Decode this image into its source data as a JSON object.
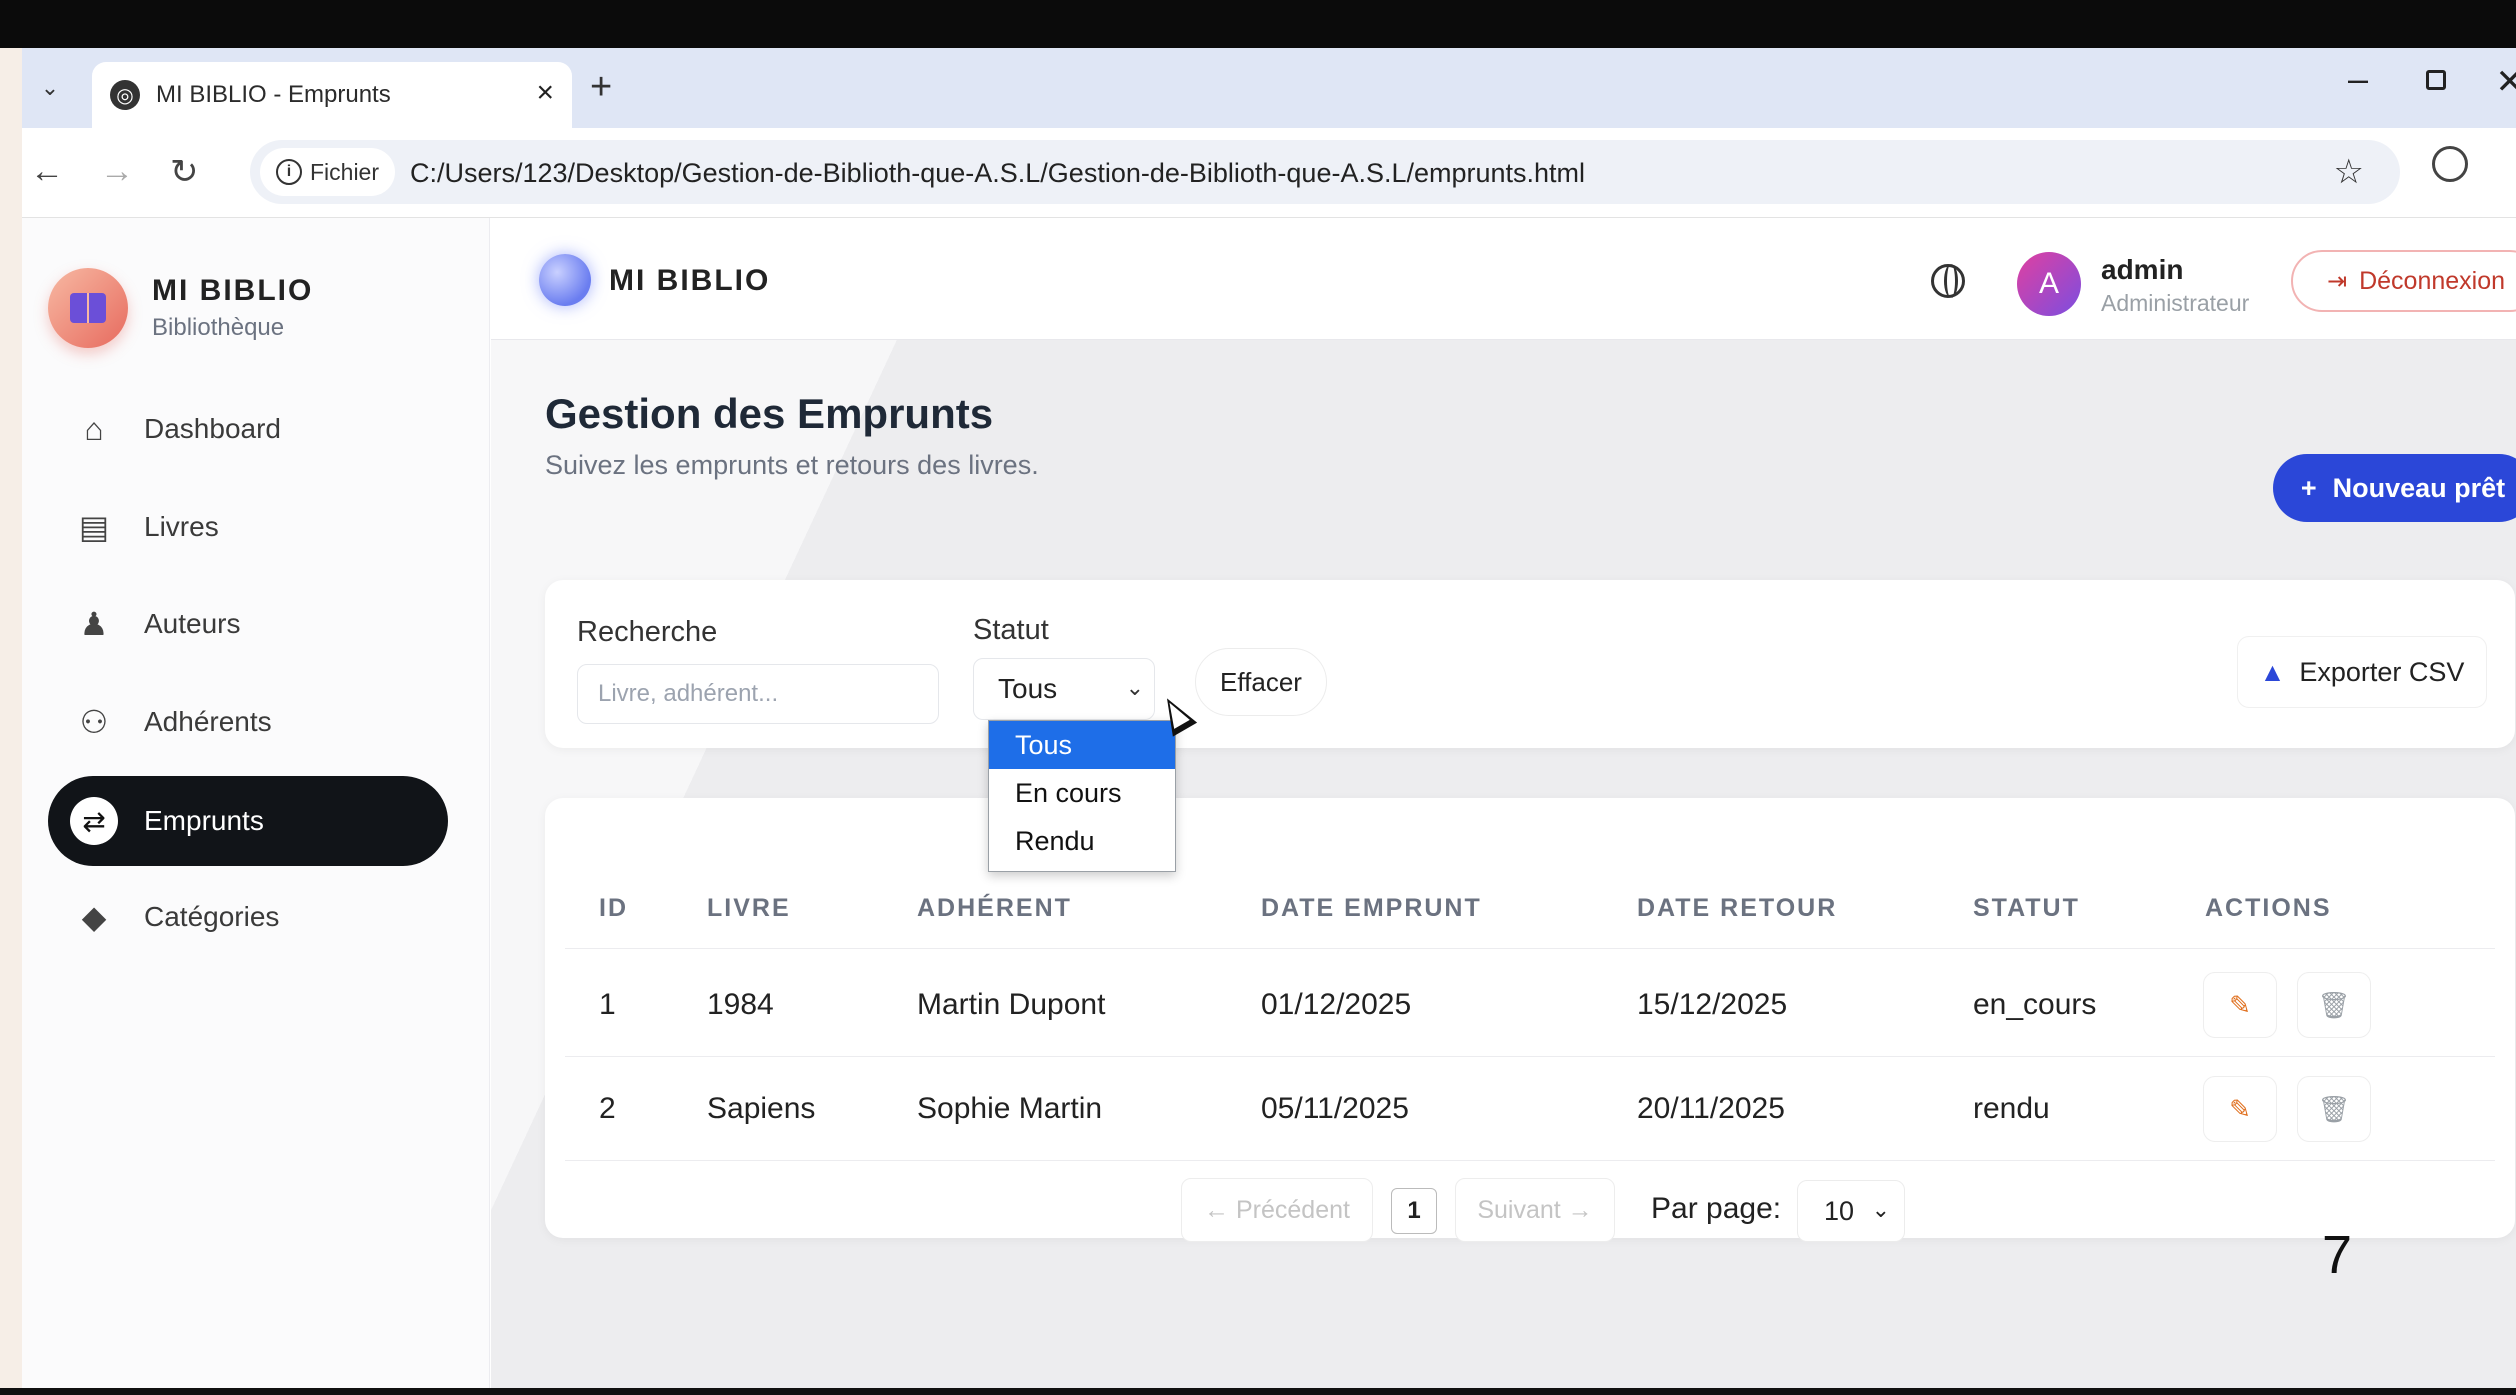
{
  "browser": {
    "tab_title": "MI BIBLIO - Emprunts",
    "tab_close": "×",
    "new_tab": "+",
    "info_label": "Fichier",
    "url": "C:/Users/123/Desktop/Gestion-de-Biblioth-que-A.S.L/Gestion-de-Biblioth-que-A.S.L/emprunts.html"
  },
  "sidebar": {
    "brand_name": "MI BIBLIO",
    "brand_sub": "Bibliothèque",
    "items": [
      {
        "label": "Dashboard",
        "icon": "home-icon",
        "active": false
      },
      {
        "label": "Livres",
        "icon": "book-icon",
        "active": false
      },
      {
        "label": "Auteurs",
        "icon": "user-icon",
        "active": false
      },
      {
        "label": "Adhérents",
        "icon": "users-icon",
        "active": false
      },
      {
        "label": "Emprunts",
        "icon": "exchange-icon",
        "active": true
      },
      {
        "label": "Catégories",
        "icon": "tags-icon",
        "active": false
      }
    ]
  },
  "header": {
    "brand": "MI BIBLIO",
    "avatar_letter": "A",
    "user_name": "admin",
    "user_role": "Administrateur",
    "logout_label": "Déconnexion"
  },
  "page": {
    "title": "Gestion des Emprunts",
    "subtitle": "Suivez les emprunts et retours des livres.",
    "new_button": "Nouveau prêt",
    "new_button_plus": "+"
  },
  "filters": {
    "search_label": "Recherche",
    "search_placeholder": "Livre, adhérent...",
    "status_label": "Statut",
    "status_value": "Tous",
    "status_options": [
      "Tous",
      "En cours",
      "Rendu"
    ],
    "clear_label": "Effacer",
    "export_label": "Exporter CSV"
  },
  "table": {
    "headers": [
      "ID",
      "LIVRE",
      "ADHÉRENT",
      "DATE EMPRUNT",
      "DATE RETOUR",
      "STATUT",
      "ACTIONS"
    ],
    "rows": [
      {
        "id": "1",
        "livre": "1984",
        "adherent": "Martin Dupont",
        "date_emprunt": "01/12/2025",
        "date_retour": "15/12/2025",
        "statut": "en_cours"
      },
      {
        "id": "2",
        "livre": "Sapiens",
        "adherent": "Sophie Martin",
        "date_emprunt": "05/11/2025",
        "date_retour": "20/11/2025",
        "statut": "rendu"
      }
    ]
  },
  "pagination": {
    "prev_label": "← Précédent",
    "current_page": "1",
    "next_label": "Suivant →",
    "per_page_label": "Par page:",
    "per_page_value": "10"
  },
  "overlay": {
    "page_number": "7"
  },
  "colors": {
    "primary": "#2b47d8",
    "active_nav": "#111418",
    "dropdown_selected": "#1e6ee8",
    "logout": "#c0392b"
  }
}
